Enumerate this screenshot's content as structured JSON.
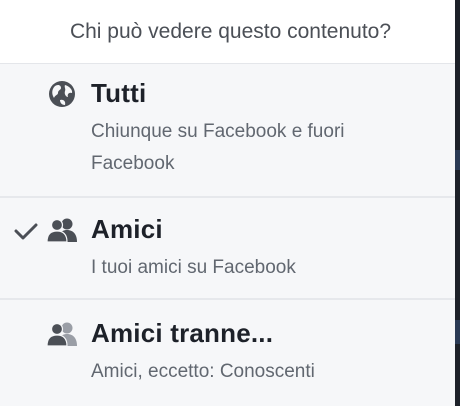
{
  "header": {
    "title": "Chi può vedere questo contenuto?"
  },
  "options": [
    {
      "icon": "globe-icon",
      "title": "Tutti",
      "description": "Chiunque su Facebook e fuori Facebook",
      "selected": false
    },
    {
      "icon": "friends-icon",
      "title": "Amici",
      "description": "I tuoi amici su Facebook",
      "selected": true
    },
    {
      "icon": "friends-except-icon",
      "title": "Amici tranne...",
      "description": "Amici, eccetto: Conoscenti",
      "selected": false
    }
  ],
  "colors": {
    "title": "#1d2129",
    "description": "#616770",
    "option_background": "#f6f7f9",
    "icon": "#4b4f56",
    "checkmark": "#4b4f56"
  }
}
